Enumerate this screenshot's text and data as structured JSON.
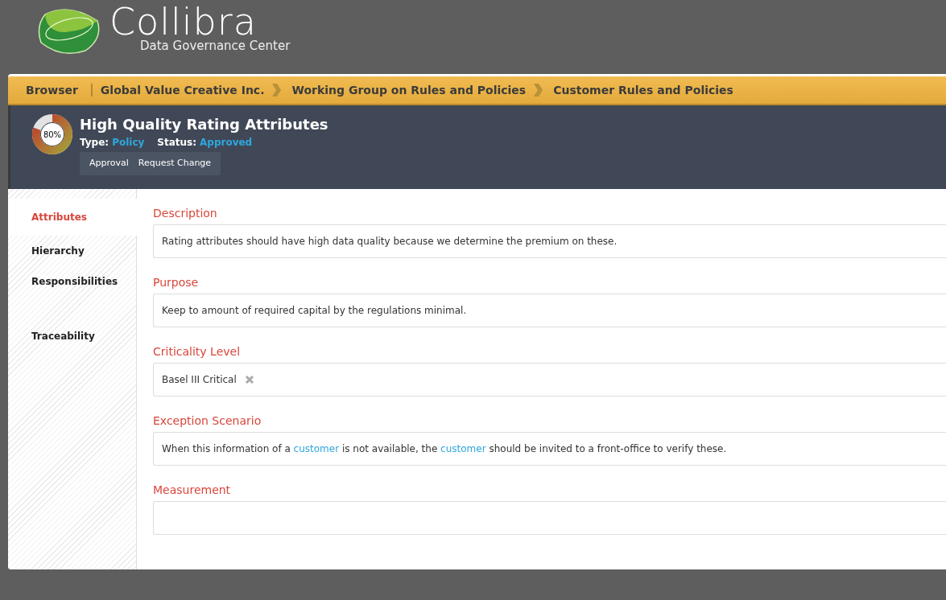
{
  "logo": {
    "name": "Collibra",
    "subtitle": "Data Governance Center"
  },
  "breadcrumb": [
    {
      "label": "Browser",
      "kind": "root"
    },
    {
      "label": "Global Value Creative Inc.",
      "kind": "crumb"
    },
    {
      "label": "Working Group on Rules and Policies",
      "kind": "crumb"
    },
    {
      "label": "Customer Rules and Policies",
      "kind": "crumb"
    }
  ],
  "asset": {
    "title": "High Quality Rating Attributes",
    "completeness": {
      "label": "80%",
      "level": 0.8
    },
    "meta": [
      {
        "label": "Type:",
        "value": "Policy"
      },
      {
        "label": "Status:",
        "value": "Approved"
      }
    ],
    "actions": [
      "Approval",
      "Request Change"
    ]
  },
  "sidebar": {
    "items": [
      {
        "label": "Attributes",
        "selected": true
      },
      {
        "label": "Hierarchy",
        "selected": false
      },
      {
        "label": "Responsibilities",
        "selected": false
      },
      {
        "label": "Traceability",
        "selected": false
      }
    ]
  },
  "attributes": [
    {
      "label": "Description",
      "kind": "text",
      "segments": [
        {
          "text": "Rating attributes should have high data quality because we determine the premium on these.",
          "kind": "text"
        }
      ]
    },
    {
      "label": "Purpose",
      "kind": "text",
      "segments": [
        {
          "text": "Keep to amount of required capital by the regulations minimal.",
          "kind": "text"
        }
      ]
    },
    {
      "label": "Criticality Level",
      "kind": "tags",
      "tags": [
        "Basel III Critical"
      ]
    },
    {
      "label": "Exception Scenario",
      "kind": "text",
      "segments": [
        {
          "text": "When this information of a ",
          "kind": "text"
        },
        {
          "text": "customer",
          "kind": "link"
        },
        {
          "text": " is not available, the ",
          "kind": "text"
        },
        {
          "text": "customer",
          "kind": "link"
        },
        {
          "text": " should be invited to a front-office to verify these.",
          "kind": "text"
        }
      ]
    },
    {
      "label": "Measurement",
      "kind": "text"
    }
  ]
}
